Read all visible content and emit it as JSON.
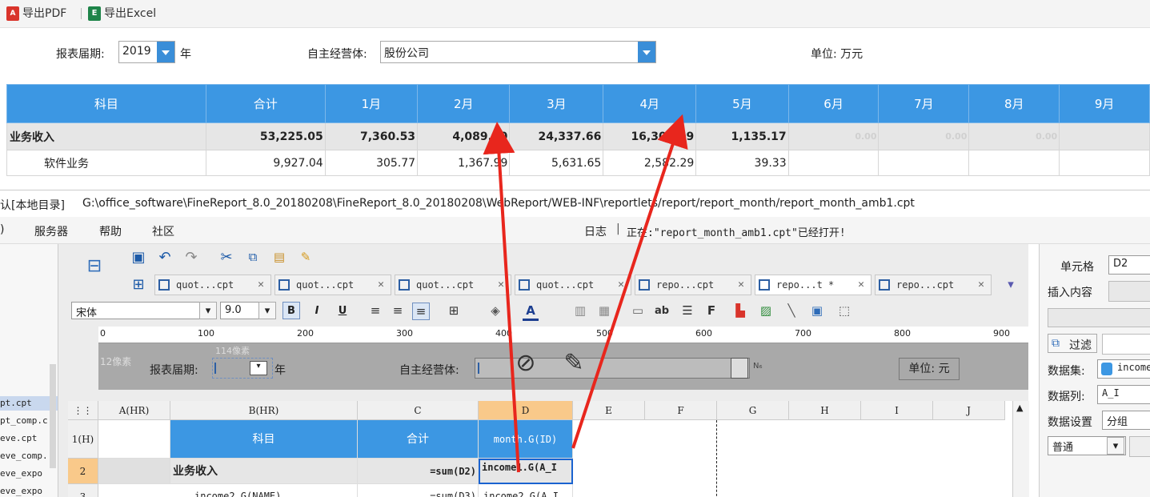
{
  "toolbar": {
    "export_pdf": "导出PDF",
    "export_excel": "导出Excel"
  },
  "params": {
    "period_label": "报表届期:",
    "period_value": "2019",
    "year_suffix": "年",
    "entity_label": "自主经营体:",
    "entity_value": "股份公司",
    "unit_label": "单位: 万元"
  },
  "table": {
    "headers": [
      "科目",
      "合计",
      "1月",
      "2月",
      "3月",
      "4月",
      "5月",
      "6月",
      "7月",
      "8月",
      "9月"
    ],
    "rows": [
      {
        "cells": [
          "业务收入",
          "53,225.05",
          "7,360.53",
          "4,089.60",
          "24,337.66",
          "16,302.09",
          "1,135.17",
          "0.00",
          "0.00",
          "0.00",
          ""
        ]
      },
      {
        "cells": [
          "软件业务",
          "9,927.04",
          "305.77",
          "1,367.99",
          "5,631.65",
          "2,582.29",
          "39.33",
          "",
          "",
          "",
          ""
        ]
      }
    ]
  },
  "designer": {
    "path_prefix": "认[本地目录]",
    "path": "G:\\office_software\\FineReport_8.0_20180208\\FineReport_8.0_20180208\\WebReport/WEB-INF\\reportlets/report/report_month/report_month_amb1.cpt",
    "menus": [
      ")",
      "服务器",
      "帮助",
      "社区"
    ],
    "log_label": "日志",
    "status_text": "正在:\"report_month_amb1.cpt\"已经打开!",
    "left_files": [
      "pt.cpt",
      "pt_comp.c",
      "eve.cpt",
      "eve_comp.",
      "eve_expo",
      "eve_expo"
    ],
    "tabs": [
      {
        "label": "quot...cpt"
      },
      {
        "label": "quot...cpt"
      },
      {
        "label": "quot...cpt"
      },
      {
        "label": "quot...cpt"
      },
      {
        "label": "repo...cpt"
      },
      {
        "label": "repo...t *"
      },
      {
        "label": "repo...cpt"
      }
    ],
    "font_name": "宋体",
    "font_size": "9.0",
    "ruler_marks": [
      "0",
      "100",
      "200",
      "300",
      "400",
      "500",
      "600",
      "700",
      "800",
      "900"
    ],
    "param_form": {
      "px_label": "12像素",
      "width_label": "114像素",
      "period_label": "报表届期:",
      "year_label": "年",
      "entity_label": "自主经营体:",
      "unit_label": "单位: 元",
      "na_label": "N₆"
    },
    "columns": [
      "A(HR)",
      "B(HR)",
      "C",
      "D",
      "E",
      "F",
      "G",
      "H",
      "I",
      "J"
    ],
    "rows": [
      "1(H)",
      "2",
      "3"
    ],
    "cells": {
      "b1": "科目",
      "c1": "合计",
      "d1": "month.G(ID)",
      "b2": "业务收入",
      "c2": "=sum(D2)",
      "d2": "income1.G(A_I",
      "b3": "income2.G(NAME)",
      "c3": "=sum(D3)",
      "d3": "income2.G(A_I"
    },
    "right_panel": {
      "cell_label": "单元格",
      "cell_value": "D2",
      "insert_label": "插入内容",
      "filter_label": "过滤",
      "dataset_label": "数据集:",
      "dataset_value": "income",
      "datacol_label": "数据列:",
      "datacol_value": "A_I",
      "datasetting_label": "数据设置",
      "datasetting_value": "分组",
      "mode_value": "普通"
    }
  },
  "colors": {
    "header_blue": "#3c97e3",
    "arrow_red": "#e8261d",
    "dropdown_blue": "#3a8ed8"
  }
}
